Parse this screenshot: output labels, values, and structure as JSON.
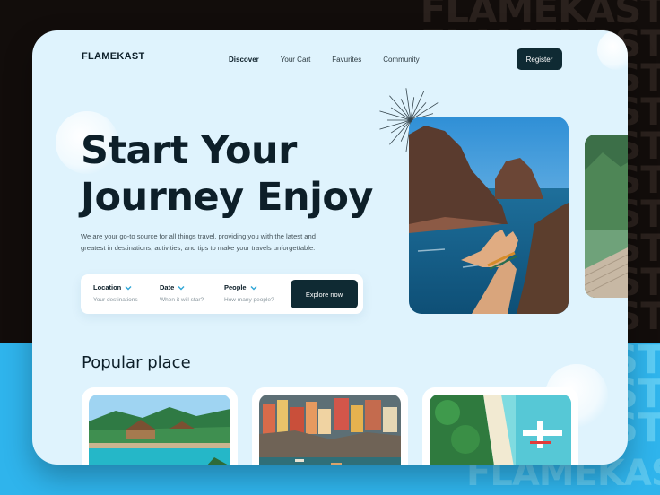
{
  "brand": {
    "watermark": "FLAMEKAST",
    "watermark_side": "KAST"
  },
  "header": {
    "logo": "FLAMEKAST",
    "nav": [
      "Discover",
      "Your Cart",
      "Favurites",
      "Community"
    ],
    "active_nav": "Discover",
    "register_label": "Register"
  },
  "hero": {
    "title_line1": "Start Your",
    "title_line2": "Journey Enjoy",
    "description_line1": "We are your go-to source for all things travel, providing you with the latest and",
    "description_line2": "greatest in destinations, activities, and tips to make your travels unforgettable."
  },
  "search": {
    "location_label": "Location",
    "location_placeholder": "Your destinations",
    "date_label": "Date",
    "date_placeholder": "When it will star?",
    "people_label": "People",
    "people_placeholder": "How many people?",
    "button_label": "Explore now"
  },
  "popular": {
    "title": "Popular place"
  },
  "colors": {
    "card_bg": "#dff3fd",
    "primary_dark": "#0f2a33",
    "accent_blue": "#2fb4ec",
    "frame_dark": "#120d0b"
  },
  "icons": [
    "chevron-down-icon",
    "sunburst-icon"
  ]
}
